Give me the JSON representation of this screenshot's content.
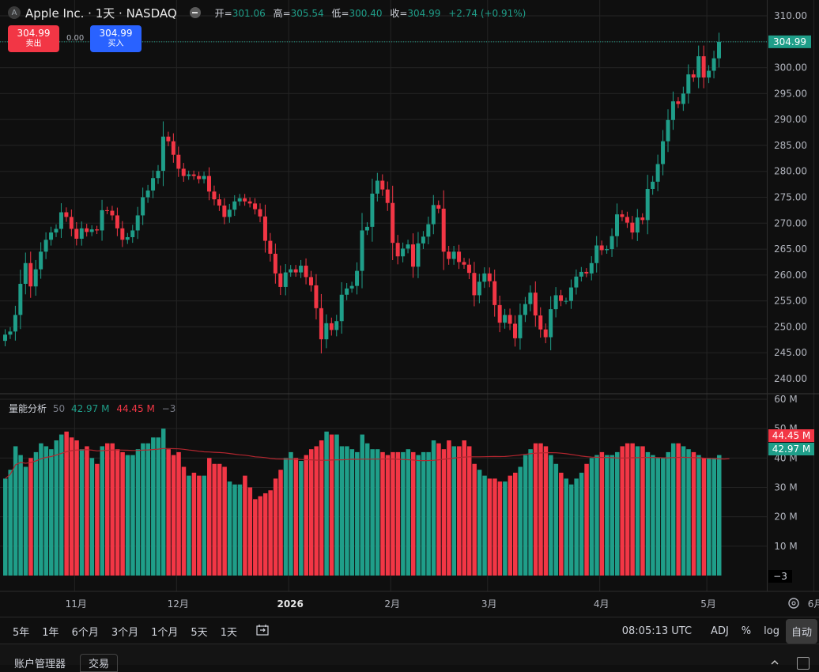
{
  "header": {
    "logo_letter": "A",
    "title": "Apple Inc. · 1天 · NASDAQ",
    "open_label": "开=",
    "open": "301.06",
    "high_label": "高=",
    "high": "305.54",
    "low_label": "低=",
    "low": "300.40",
    "close_label": "收=",
    "close": "304.99",
    "change": "+2.74 (+0.91%)"
  },
  "trade": {
    "sell_price": "304.99",
    "sell_label": "卖出",
    "spread": "0.00",
    "buy_price": "304.99",
    "buy_label": "买入"
  },
  "volume_legend": {
    "name": "量能分析",
    "period": "50",
    "value1": "42.97 M",
    "value2": "44.45 M",
    "value3": "−3"
  },
  "bottom": {
    "ranges": [
      "5年",
      "1年",
      "6个月",
      "3个月",
      "1个月",
      "5天",
      "1天"
    ],
    "time": "08:05:13 UTC",
    "adj": "ADJ",
    "percent": "%",
    "log": "log",
    "auto": "自动"
  },
  "panel": {
    "account": "账户管理器",
    "trade_tab": "交易"
  },
  "colors": {
    "up": "#1f9e89",
    "down": "#f23645",
    "ma": "#b3262f",
    "background": "#0f0f0f",
    "grid": "#242424"
  },
  "chart_data": {
    "type": "candlestick",
    "price_axis": {
      "min": 240,
      "max": 310,
      "ticks": [
        "310.00",
        "305.00",
        "300.00",
        "295.00",
        "290.00",
        "285.00",
        "280.00",
        "275.00",
        "270.00",
        "265.00",
        "260.00",
        "255.00",
        "250.00",
        "245.00",
        "240.00"
      ],
      "last_label": "304.99"
    },
    "volume_axis": {
      "max": 60,
      "unit": "M",
      "ticks": [
        "60 M",
        "50 M",
        "40 M",
        "30 M",
        "20 M",
        "10 M"
      ],
      "bottom_label": "−3",
      "last_labels": [
        "44.45 M",
        "42.97 M"
      ]
    },
    "time_axis": {
      "labels": [
        {
          "text": "11月",
          "bar": 14,
          "bold": false
        },
        {
          "text": "12月",
          "bar": 34,
          "bold": false
        },
        {
          "text": "2026",
          "bar": 56,
          "bold": true
        },
        {
          "text": "2月",
          "bar": 76,
          "bold": false
        },
        {
          "text": "3月",
          "bar": 95,
          "bold": false
        },
        {
          "text": "4月",
          "bar": 117,
          "bold": false
        },
        {
          "text": "5月",
          "bar": 138,
          "bold": false
        },
        {
          "text": "6月",
          "bar": 159,
          "bold": false
        }
      ]
    },
    "closes": [
      248.5,
      249.1,
      252.3,
      258.3,
      262.3,
      257.8,
      261.1,
      264.5,
      266.8,
      268.2,
      268.9,
      272.1,
      271.2,
      268.9,
      267.0,
      269.0,
      268.3,
      268.8,
      268.6,
      272.5,
      272.4,
      271.5,
      269.0,
      266.8,
      267.3,
      268.6,
      271.5,
      275.0,
      276.3,
      278.7,
      280.1,
      286.7,
      285.8,
      283.2,
      280.5,
      279.1,
      279.4,
      279.1,
      278.5,
      279.1,
      276.1,
      274.6,
      273.4,
      271.2,
      272.6,
      274.2,
      274.8,
      274.2,
      273.8,
      272.7,
      271.3,
      266.6,
      264.1,
      260.3,
      257.7,
      260.5,
      261.1,
      260.5,
      261.8,
      259.6,
      258.0,
      253.6,
      247.6,
      250.7,
      249.4,
      251.1,
      256.2,
      257.4,
      257.9,
      260.8,
      268.6,
      269.3,
      275.7,
      278.2,
      276.5,
      273.9,
      266.2,
      263.6,
      265.1,
      265.9,
      261.6,
      266.1,
      267.4,
      269.8,
      273.5,
      272.8,
      264.5,
      263.1,
      264.5,
      262.5,
      262.0,
      260.4,
      256.1,
      258.7,
      260.3,
      258.8,
      254.2,
      250.8,
      252.3,
      250.6,
      247.8,
      252.3,
      254.4,
      256.6,
      252.2,
      249.5,
      248.0,
      253.4,
      256.1,
      255.0,
      255.0,
      257.6,
      259.7,
      260.6,
      260.3,
      262.3,
      265.7,
      264.8,
      265.0,
      267.5,
      271.7,
      271.2,
      270.1,
      268.2,
      271.1,
      270.6,
      276.6,
      278.0,
      281.4,
      285.8,
      289.9,
      293.5,
      293.0,
      295.0,
      298.7,
      298.1,
      302.2,
      298.1,
      299.4,
      301.8,
      304.99
    ],
    "volumes": [
      33,
      36,
      44,
      41,
      37,
      40,
      42,
      45,
      44,
      43,
      46,
      48,
      49,
      47,
      46,
      43,
      44,
      40,
      38,
      44,
      45,
      45,
      43,
      42,
      41,
      41,
      43,
      45,
      45,
      47,
      47,
      50,
      43,
      41,
      42,
      37,
      34,
      35,
      34,
      34,
      40,
      38,
      38,
      37,
      32,
      31,
      31,
      34,
      30,
      26,
      27,
      28,
      29,
      33,
      36,
      40,
      42,
      40,
      39,
      41,
      43,
      44,
      46,
      49,
      48,
      48,
      44,
      44,
      43,
      42,
      48,
      45,
      43,
      43,
      42,
      41,
      42,
      42,
      42,
      43,
      42,
      41,
      42,
      42,
      46,
      45,
      43,
      46,
      44,
      44,
      46,
      44,
      38,
      36,
      34,
      33,
      33,
      32,
      32,
      34,
      35,
      37,
      41,
      43,
      45,
      45,
      44,
      41,
      38,
      35,
      33,
      31,
      33,
      35,
      38,
      40,
      41,
      42,
      41,
      41,
      42,
      44,
      45,
      45,
      44,
      44,
      42,
      41,
      40,
      40,
      42,
      45,
      45,
      44,
      43,
      42,
      41,
      40,
      40,
      40,
      41,
      42,
      43
    ]
  }
}
